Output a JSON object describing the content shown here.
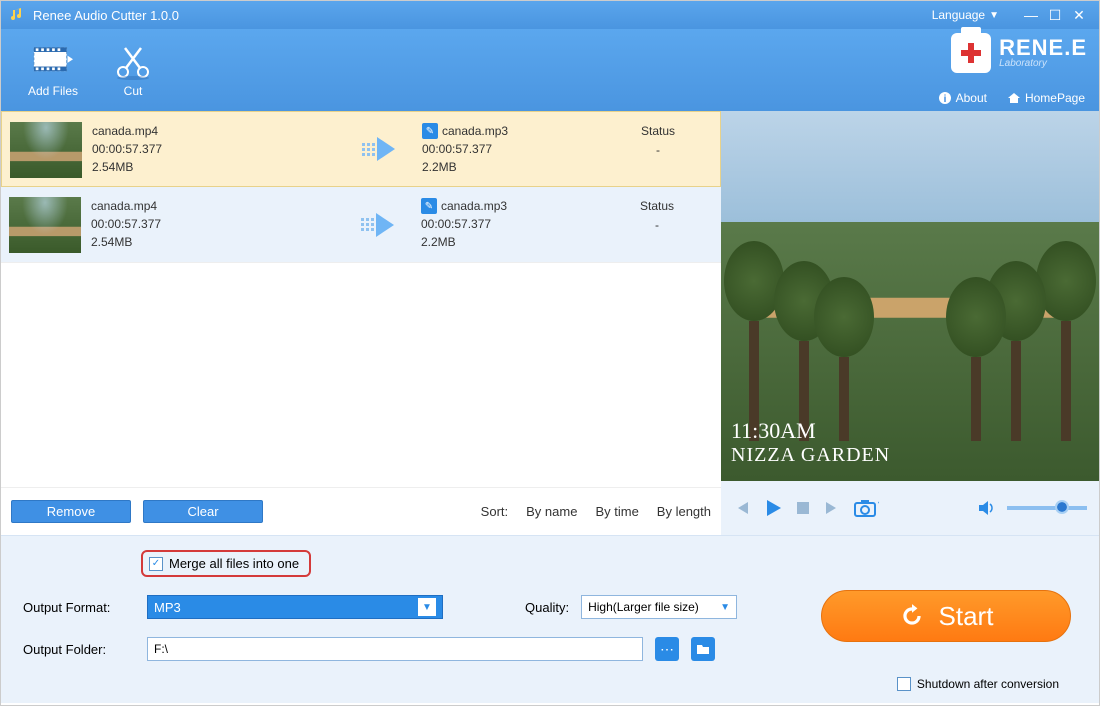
{
  "titlebar": {
    "title": "Renee Audio Cutter 1.0.0",
    "language_label": "Language"
  },
  "toolbar": {
    "add_files": "Add Files",
    "cut": "Cut"
  },
  "logo": {
    "brand": "RENE.E",
    "tagline": "Laboratory"
  },
  "header_links": {
    "about": "About",
    "homepage": "HomePage"
  },
  "files": [
    {
      "src_name": "canada.mp4",
      "src_duration": "00:00:57.377",
      "src_size": "2.54MB",
      "out_name": "canada.mp3",
      "out_duration": "00:00:57.377",
      "out_size": "2.2MB",
      "status_label": "Status",
      "status_value": "-",
      "selected": true
    },
    {
      "src_name": "canada.mp4",
      "src_duration": "00:00:57.377",
      "src_size": "2.54MB",
      "out_name": "canada.mp3",
      "out_duration": "00:00:57.377",
      "out_size": "2.2MB",
      "status_label": "Status",
      "status_value": "-",
      "selected": false
    }
  ],
  "listbar": {
    "remove": "Remove",
    "clear": "Clear",
    "sort_label": "Sort:",
    "by_name": "By name",
    "by_time": "By time",
    "by_length": "By length"
  },
  "preview": {
    "overlay_time": "11:30AM",
    "overlay_place": "NIZZA GARDEN"
  },
  "settings": {
    "merge_label": "Merge all files into one",
    "merge_checked": true,
    "format_label": "Output Format:",
    "format_value": "MP3",
    "quality_label": "Quality:",
    "quality_value": "High(Larger file size)",
    "folder_label": "Output Folder:",
    "folder_value": "F:\\",
    "start_label": "Start",
    "shutdown_label": "Shutdown after conversion",
    "shutdown_checked": false
  }
}
